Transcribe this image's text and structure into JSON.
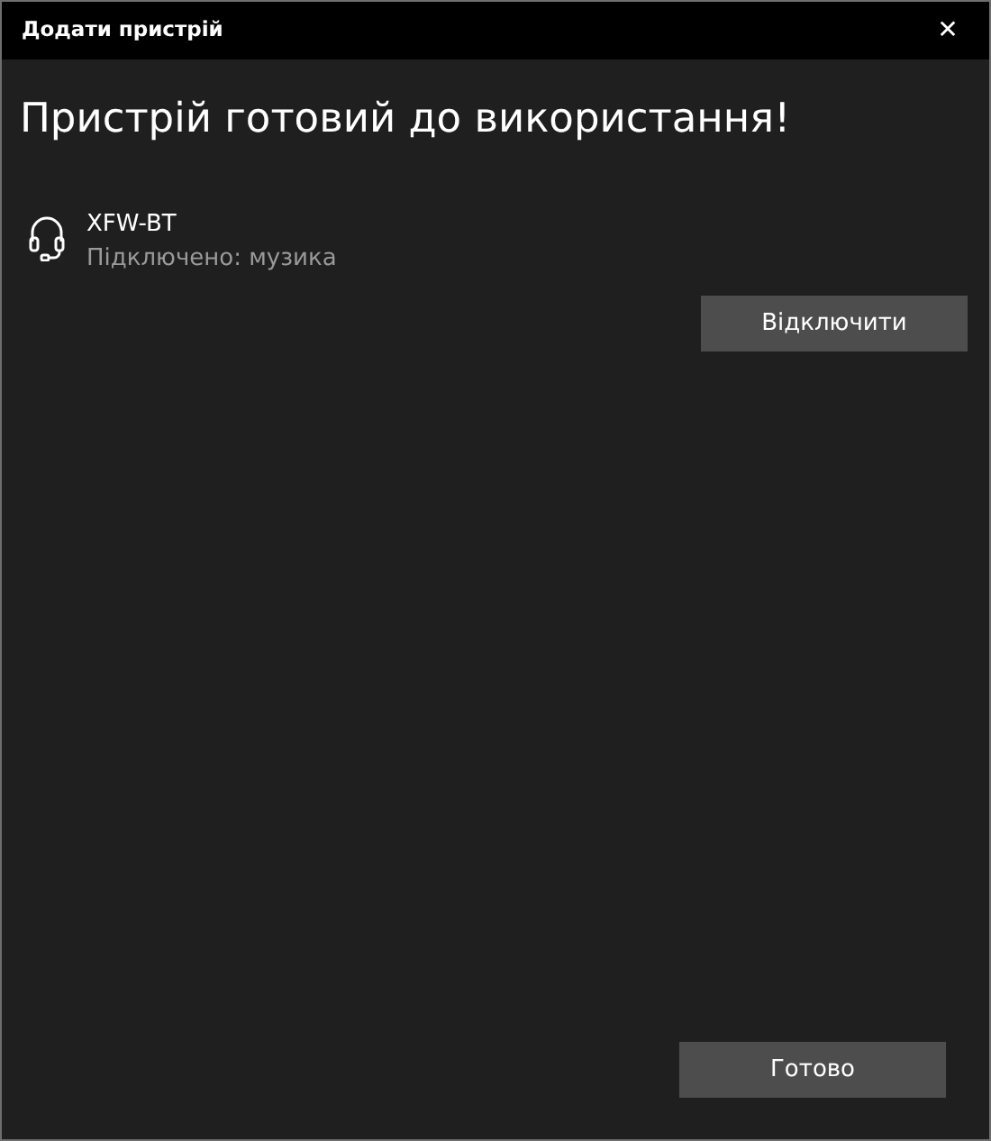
{
  "window": {
    "title": "Додати пристрій",
    "close": "✕"
  },
  "heading": "Пристрій готовий до використання!",
  "device": {
    "name": "XFW-BT",
    "status": "Підключено: музика",
    "action": "Відключити"
  },
  "buttons": [
    "Готово"
  ]
}
